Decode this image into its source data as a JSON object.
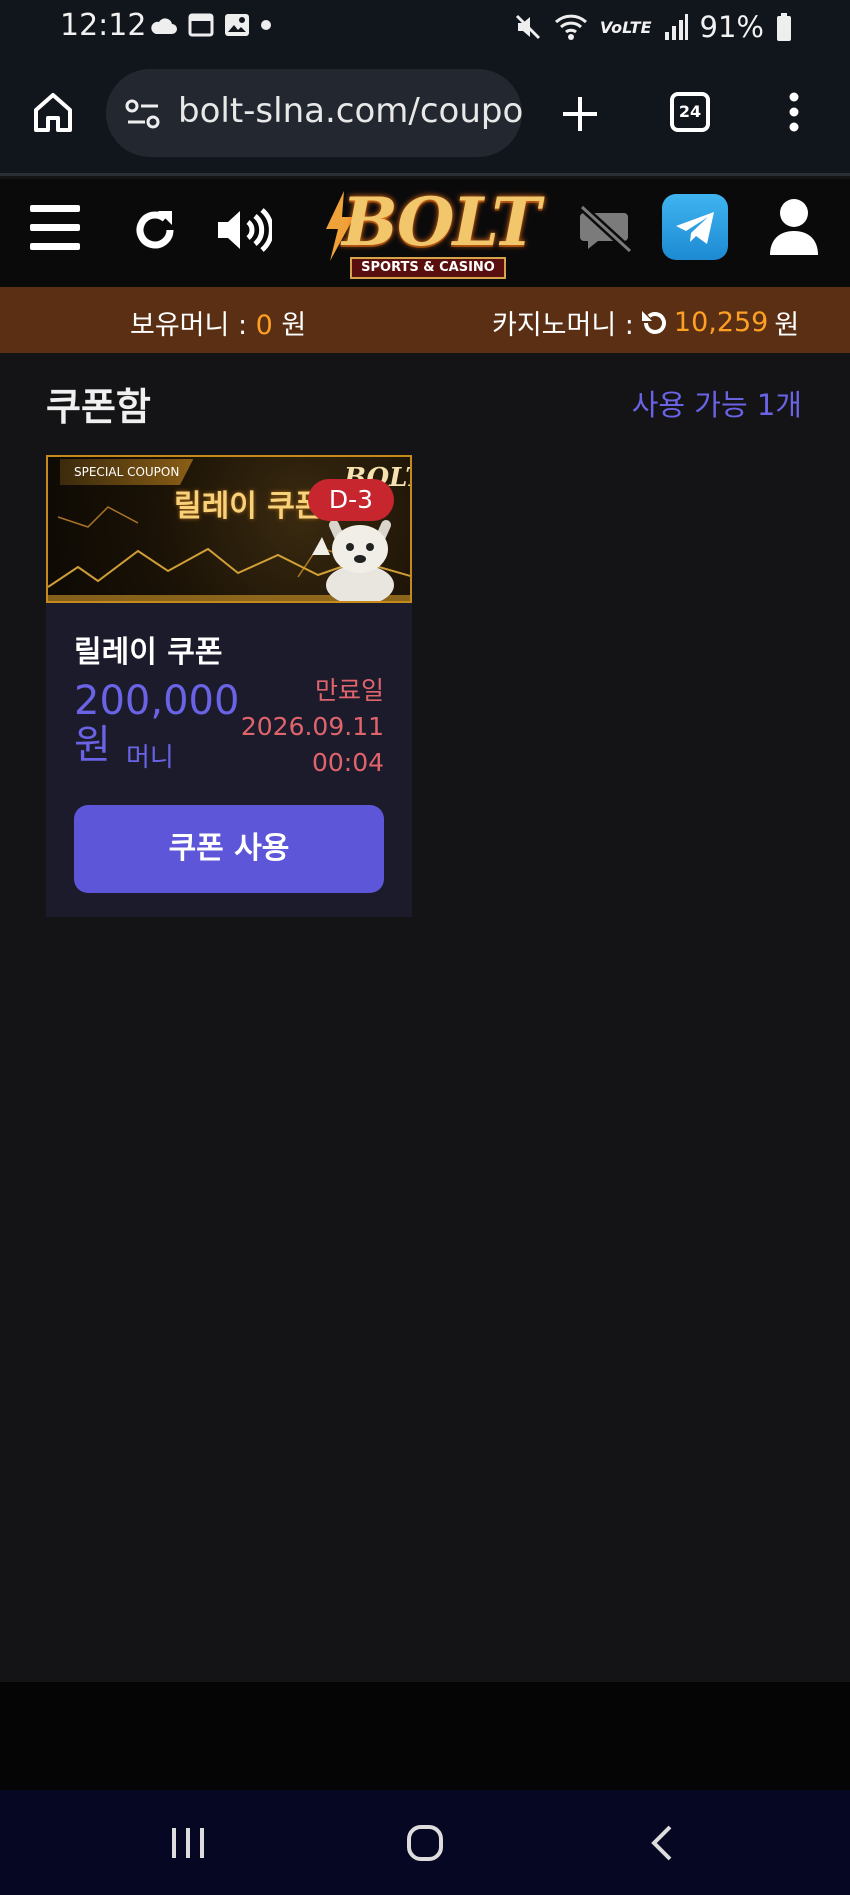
{
  "status_bar": {
    "time": "12:12",
    "battery": "91%",
    "icons": [
      "cloud-icon",
      "calendar-icon",
      "image-icon",
      "dot-icon",
      "mute-icon",
      "wifi-icon",
      "volte-icon",
      "signal-icon",
      "battery-icon"
    ]
  },
  "browser": {
    "url": "bolt-slna.com/coupon",
    "tab_count": "24"
  },
  "header": {
    "logo_text": "BOLT",
    "logo_tagline": "SPORTS & CASINO"
  },
  "money_bar": {
    "held_label": "보유머니 :",
    "held_value": "0",
    "held_unit": "원",
    "casino_label": "카지노머니 :",
    "casino_value": "10,259",
    "casino_unit": "원"
  },
  "coupon_box": {
    "title": "쿠폰함",
    "available": "사용 가능 1개",
    "coupons": [
      {
        "banner_special": "SPECIAL COUPON",
        "banner_title": "릴레이 쿠폰",
        "banner_brand": "BOLT",
        "d_badge": "D-3",
        "name": "릴레이 쿠폰",
        "amount": "200,000",
        "amount_unit": "원",
        "money_type": "머니",
        "expiry_label": "만료일",
        "expiry_date": "2026.09.11",
        "expiry_time": "00:04",
        "use_button": "쿠폰 사용"
      }
    ]
  },
  "colors": {
    "accent": "#6a63e6",
    "button": "#5d56d8",
    "money_bar": "#5a2f13",
    "orange": "#ffa024",
    "expiry": "#e0646c"
  }
}
